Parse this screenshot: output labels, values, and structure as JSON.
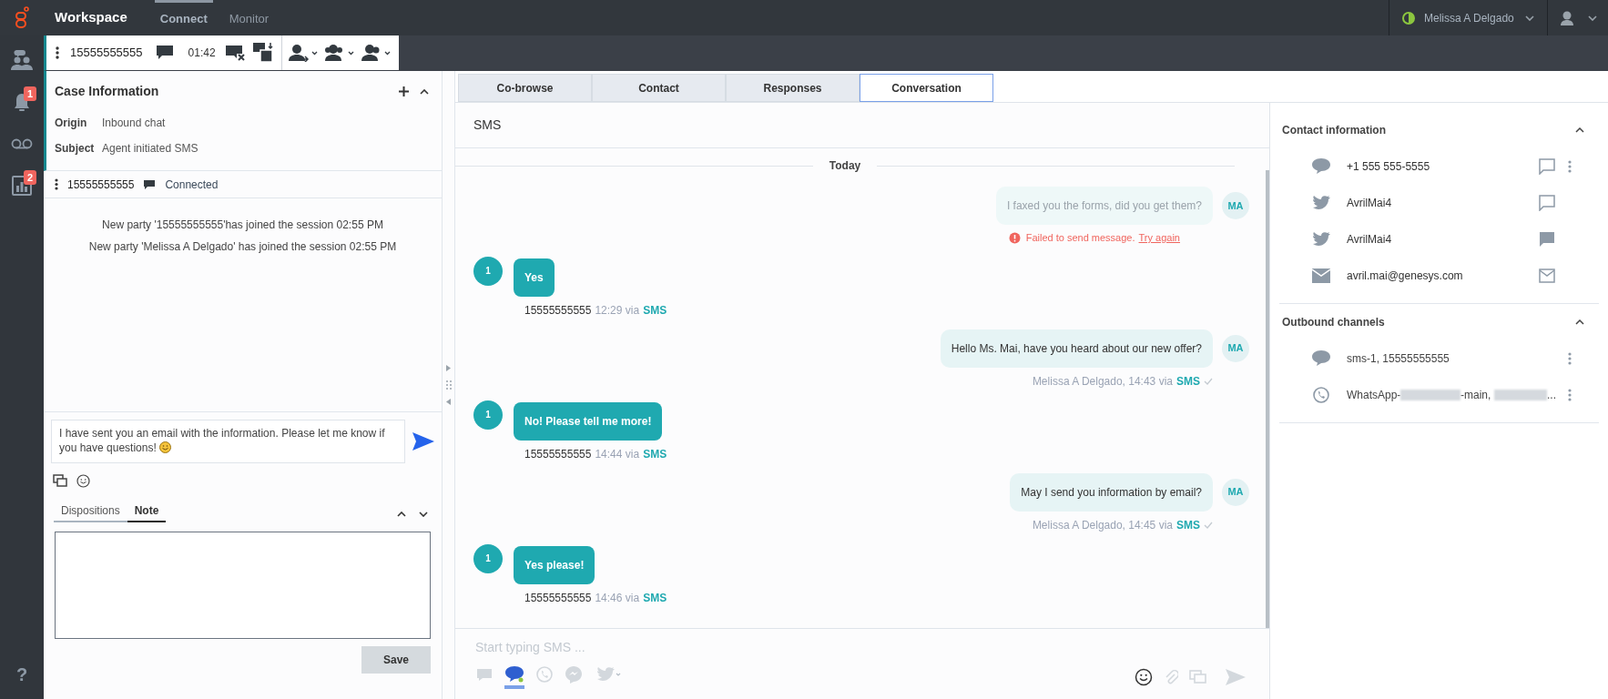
{
  "top_bar": {
    "app": "Workspace",
    "nav": [
      {
        "label": "Connect",
        "selected": true
      },
      {
        "label": "Monitor",
        "selected": false
      }
    ],
    "user": "Melissa A Delgado"
  },
  "rail": [
    {
      "kind": "agents"
    },
    {
      "kind": "bell",
      "badge": "1"
    },
    {
      "kind": "voicemail"
    },
    {
      "kind": "stats",
      "badge": "2"
    }
  ],
  "help": "?",
  "interaction_bar": {
    "number": "15555555555",
    "timer": "01:42"
  },
  "case_information": {
    "title": "Case Information",
    "fields": [
      {
        "label": "Origin",
        "value": "Inbound chat"
      },
      {
        "label": "Subject",
        "value": "Agent initiated SMS"
      }
    ]
  },
  "party": {
    "number": "15555555555",
    "status": "Connected"
  },
  "transcript": [
    "New party '15555555555'has joined the session 02:55 PM",
    "New party 'Melissa A Delgado' has joined the session 02:55 PM"
  ],
  "reply": {
    "value": "I have sent you an email with the information. Please let me know if you have questions!"
  },
  "notes": {
    "tabs": [
      {
        "label": "Dispositions",
        "selected": false
      },
      {
        "label": "Note",
        "selected": true
      }
    ],
    "save": "Save"
  },
  "tabs": [
    {
      "label": "Co-browse",
      "selected": false
    },
    {
      "label": "Contact",
      "selected": false
    },
    {
      "label": "Responses",
      "selected": false
    },
    {
      "label": "Conversation",
      "selected": true
    }
  ],
  "chat": {
    "channel": "SMS",
    "day": "Today",
    "messages": [
      {
        "kind": "agent",
        "text": "I faxed you the forms, did you get them?",
        "initials": "MA",
        "failed": true,
        "error": "Failed to send message.",
        "retry": "Try again"
      },
      {
        "kind": "customer",
        "avatar": "1",
        "text": "Yes",
        "sender": "15555555555",
        "time": "12:29 via",
        "channel": "SMS"
      },
      {
        "kind": "agent",
        "text": "Hello Ms. Mai, have you heard about our new offer?",
        "initials": "MA",
        "failed": false,
        "meta": "Melissa A Delgado, 14:43 via",
        "channel": "SMS"
      },
      {
        "kind": "customer",
        "avatar": "1",
        "text": "No! Please tell me more!",
        "sender": "15555555555",
        "time": "14:44 via",
        "channel": "SMS"
      },
      {
        "kind": "agent",
        "text": "May I send you information by email?",
        "initials": "MA",
        "failed": false,
        "meta": "Melissa A Delgado, 14:45 via",
        "channel": "SMS"
      },
      {
        "kind": "customer",
        "avatar": "1",
        "text": "Yes please!",
        "sender": "15555555555",
        "time": "14:46 via",
        "channel": "SMS"
      }
    ],
    "composer": {
      "placeholder": "Start typing SMS ..."
    },
    "channels": [
      {
        "kind": "chat",
        "selected": false
      },
      {
        "kind": "sms",
        "selected": true
      },
      {
        "kind": "whatsapp",
        "selected": false
      },
      {
        "kind": "messenger",
        "selected": false
      },
      {
        "kind": "twitter",
        "selected": false
      }
    ]
  },
  "contact_information": {
    "title": "Contact information",
    "items": [
      {
        "kind": "sms",
        "value": "+1 555 555-5555",
        "action": {
          "kind": "chat"
        },
        "more": true
      },
      {
        "kind": "twitter",
        "value": "AvrilMai4",
        "action": {
          "kind": "chat"
        },
        "more": false
      },
      {
        "kind": "twitter",
        "value": "AvrilMai4",
        "action": {
          "kind": "dm"
        },
        "more": false
      },
      {
        "kind": "email",
        "value": "avril.mai@genesys.com",
        "action": {
          "kind": "email"
        },
        "more": false
      }
    ]
  },
  "outbound_channels": {
    "title": "Outbound channels",
    "items": [
      {
        "kind": "sms",
        "parts": [
          "sms-1, 15555555555"
        ]
      },
      {
        "kind": "whatsapp",
        "parts": [
          "WhatsApp-",
          "-main,",
          "..."
        ]
      }
    ]
  }
}
